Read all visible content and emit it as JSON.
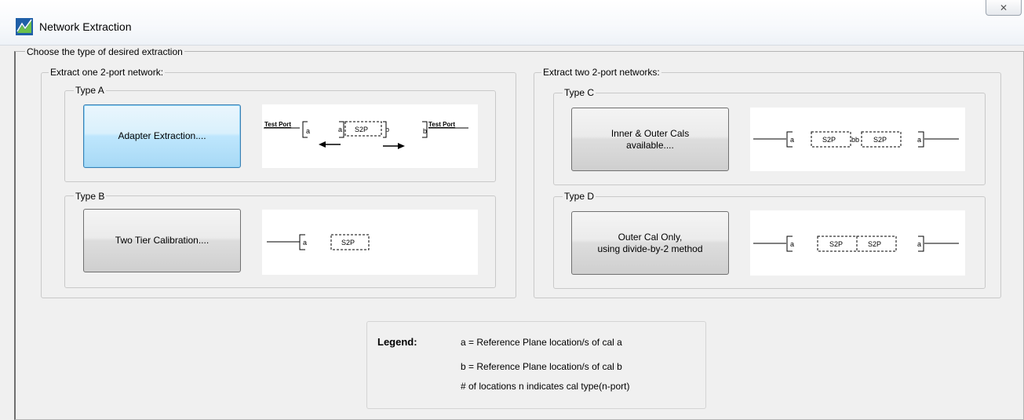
{
  "window": {
    "title": "Network Extraction",
    "close_glyph": "✕"
  },
  "main": {
    "group_label": "Choose the type of desired extraction",
    "one_port": {
      "label": "Extract one 2-port network:",
      "type_a": {
        "label": "Type A",
        "button": "Adapter Extraction....",
        "diagram": {
          "left_port": "Test Port",
          "right_port": "Test Port",
          "a1": "a",
          "a2": "a",
          "box": "S2P",
          "b1": "b",
          "b2": "b"
        }
      },
      "type_b": {
        "label": "Type B",
        "button": "Two Tier Calibration....",
        "diagram": {
          "a": "a",
          "box": "S2P"
        }
      }
    },
    "two_port": {
      "label": "Extract two 2-port networks:",
      "type_c": {
        "label": "Type C",
        "button": "Inner & Outer Cals\navailable....",
        "diagram": {
          "a_left": "a",
          "box1": "S2P",
          "bb": "bb",
          "box2": "S2P",
          "a_right": "a"
        }
      },
      "type_d": {
        "label": "Type D",
        "button": "Outer Cal Only,\nusing divide-by-2 method",
        "diagram": {
          "a_left": "a",
          "box1": "S2P",
          "box2": "S2P",
          "a_right": "a"
        }
      }
    }
  },
  "legend": {
    "title": "Legend:",
    "line1": "a = Reference Plane location/s of cal a",
    "line2": "b = Reference Plane location/s of cal b",
    "line3": "# of locations n indicates cal type(n-port)"
  }
}
